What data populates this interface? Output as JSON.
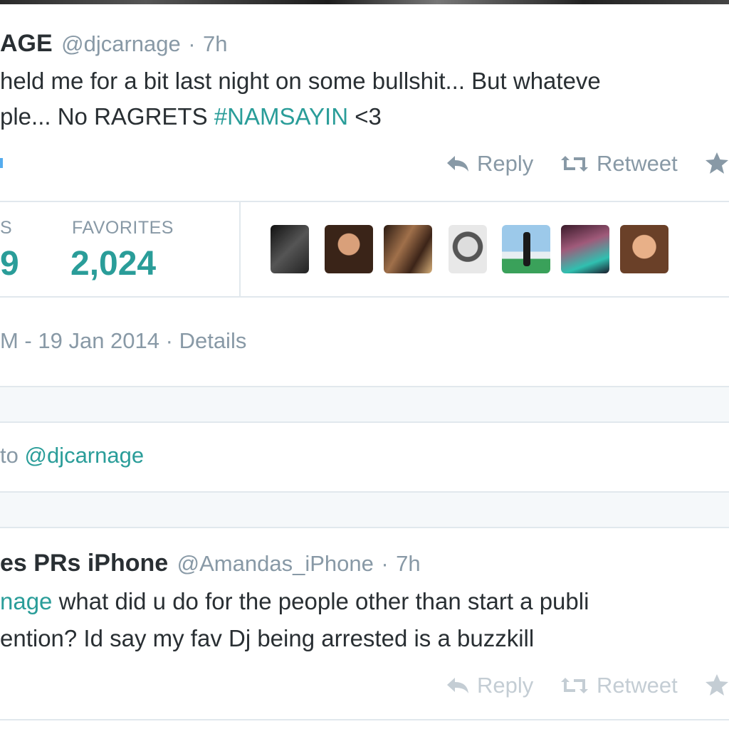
{
  "tweet": {
    "name_partial": "AGE",
    "handle": "@djcarnage",
    "dot": "·",
    "time": "7h",
    "line1": "held me for a bit last night on some bullshit... But whateve",
    "line2_prefix": "ple... No RAGRETS ",
    "hashtag": "#NAMSAYIN",
    "line2_suffix": " <3",
    "actions": {
      "reply": "Reply",
      "retweet": "Retweet"
    },
    "stats": {
      "retweets_label_partial": "S",
      "retweets_value_partial": "9",
      "favorites_label": "FAVORITES",
      "favorites_value": "2,024"
    },
    "timestamp_partial": "M - 19 Jan 2014 · ",
    "details_link": "Details"
  },
  "reply_box": {
    "to_partial": "to ",
    "mention": "@djcarnage"
  },
  "reply_tweet": {
    "name_partial": "es PRs iPhone",
    "handle": "@Amandas_iPhone",
    "dot": "·",
    "time": "7h",
    "mention_partial": "nage",
    "line1_rest": " what did u do for the people other than start a publi",
    "line2": "ention? Id say my fav Dj being arrested is a buzzkill",
    "actions": {
      "reply": "Reply",
      "retweet": "Retweet"
    }
  },
  "favoriters": [
    {
      "icon": "avatar-bw-person",
      "color": "#2b2b2b"
    },
    {
      "icon": "avatar-woman-smiling",
      "color": "#8a5a3c"
    },
    {
      "icon": "avatar-group-photo",
      "color": "#5a3a2a"
    },
    {
      "icon": "avatar-bw-glasses",
      "color": "#9a9a9a"
    },
    {
      "icon": "avatar-beach-dress",
      "color": "#6aa8d8"
    },
    {
      "icon": "avatar-woman-teal",
      "color": "#7a3a5a"
    },
    {
      "icon": "avatar-woman-portrait",
      "color": "#c98a60"
    }
  ],
  "colors": {
    "accent": "#2a9d99",
    "muted": "#8899a6",
    "text": "#292f33",
    "border": "#e1e8ed"
  }
}
